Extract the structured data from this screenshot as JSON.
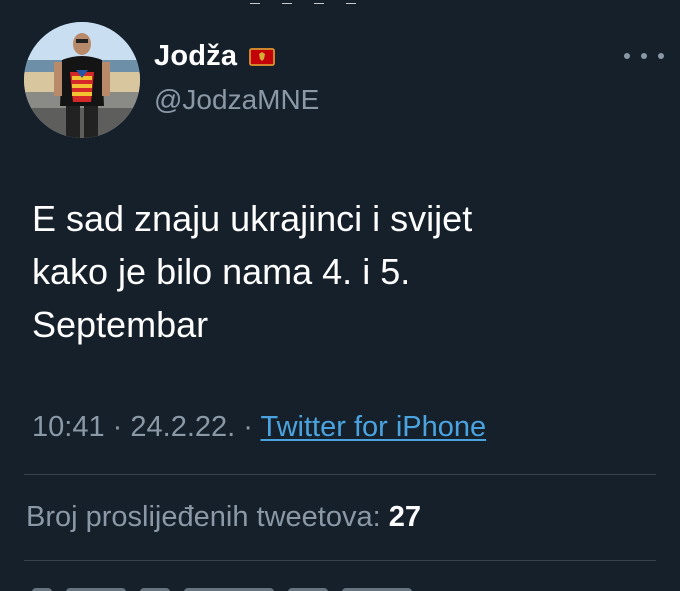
{
  "author": {
    "display_name": "Jodža",
    "handle": "@JodzaMNE",
    "flag_icon": "montenegro-flag-icon",
    "more_icon": "more-options-icon"
  },
  "tweet": {
    "lines": [
      "E sad znaju ukrajinci i svijet",
      "kako je bilo nama 4. i 5.",
      "Septembar"
    ]
  },
  "meta": {
    "time": "10:41",
    "separator": "·",
    "date": "24.2.22.",
    "source": "Twitter for iPhone"
  },
  "stats": {
    "retweets_label": "Broj proslijeđenih tweetova:",
    "retweets_count": "27"
  },
  "colors": {
    "background": "#15202b",
    "primary_text": "#ffffff",
    "secondary_text": "#8b98a5",
    "link": "#4aa3df",
    "divider": "#38444d"
  }
}
